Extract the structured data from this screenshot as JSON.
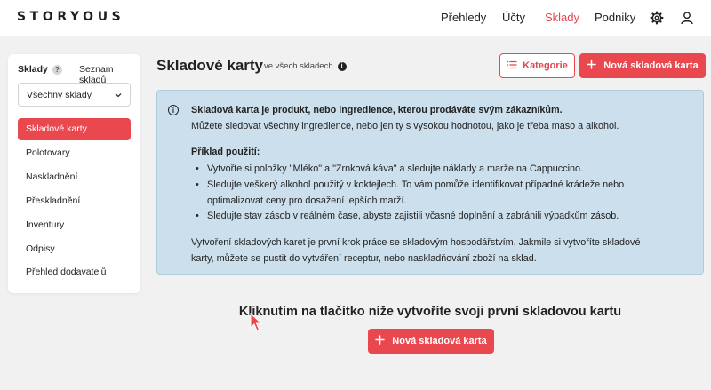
{
  "header": {
    "logo": "STORYOUS",
    "nav": [
      "Přehledy",
      "Účty",
      "Sklady",
      "Podniky"
    ],
    "active_nav": "Sklady"
  },
  "sidebar": {
    "heading": "Sklady",
    "help_badge": "?",
    "link": "Seznam skladů",
    "select_value": "Všechny sklady",
    "items": [
      "Skladové karty",
      "Polotovary",
      "Naskladnění",
      "Přeskladnění",
      "Inventury",
      "Odpisy",
      "Přehled dodavatelů"
    ]
  },
  "main": {
    "title": "Skladové karty",
    "subtitle": "ve všech skladech",
    "category_button": "Kategorie",
    "new_card_button": "Nová skladová karta",
    "info": {
      "heading": "Skladová karta je produkt, nebo ingredience, kterou prodáváte svým zákazníkům.",
      "intro": "Můžete sledovat všechny ingredience, nebo jen ty s vysokou hodnotou, jako je třeba maso a alkohol.",
      "example_heading": "Příklad použití:",
      "bullets": [
        [
          "Vytvořte si položky \"Mléko\" a \"Zrnková káva\" a sledujte náklady a marže na Cappuccino."
        ],
        [
          "Sledujte veškerý alkohol použitý v koktejlech. To vám pomůže identifikovat případné krádeže nebo",
          "optimalizovat ceny pro dosažení lepších marží."
        ],
        [
          "Sledujte stav zásob v reálném čase, abyste zajistili včasné doplnění a zabránili výpadkům zásob."
        ]
      ],
      "footer": [
        "Vytvoření skladových karet je první krok práce se skladovým hospodářstvím. Jakmile si vytvoříte skladové",
        "karty, můžete se pustit do vytváření receptur, nebo naskladňování zboží na sklad."
      ]
    },
    "cta_text": "Kliknutím na tlačítko níže vytvoříte svoji první skladovou kartu",
    "cta_button": "Nová skladová karta"
  },
  "colors": {
    "accent": "#e9484f",
    "info_bg": "#cbdfec"
  }
}
